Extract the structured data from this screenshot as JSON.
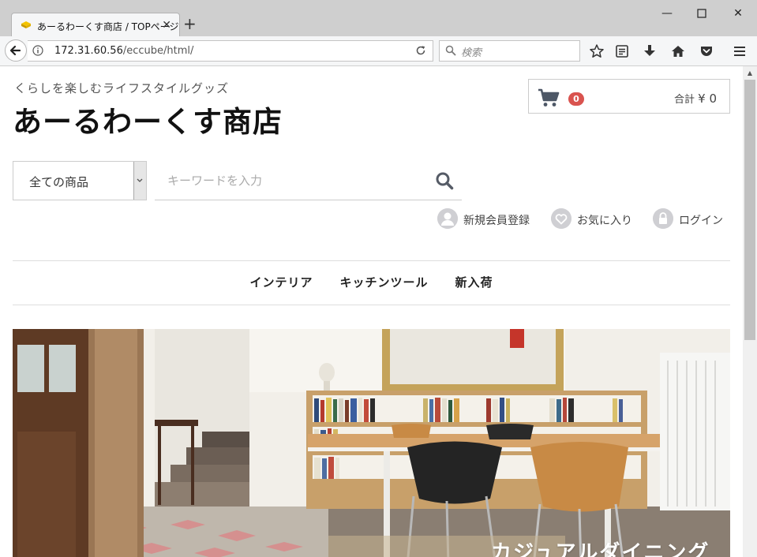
{
  "browser": {
    "tab_title": "あーるわーくす商店 / TOPページ",
    "url_host": "172.31.60.56",
    "url_path": "/eccube/html/",
    "search_placeholder": "検索"
  },
  "header": {
    "tagline": "くらしを楽しむライフスタイルグッズ",
    "shop_name": "あーるわーくす商店"
  },
  "cart": {
    "count": "0",
    "total_label": "合計",
    "total_value": "¥ 0"
  },
  "search": {
    "category_selected": "全ての商品",
    "keyword_placeholder": "キーワードを入力"
  },
  "member_links": {
    "register": "新規会員登録",
    "favorites": "お気に入り",
    "login": "ログイン"
  },
  "category_nav": [
    "インテリア",
    "キッチンツール",
    "新入荷"
  ],
  "hero": {
    "caption": "カジュアルダイニング"
  },
  "colors": {
    "badge": "#d9534f",
    "text": "#222222"
  }
}
